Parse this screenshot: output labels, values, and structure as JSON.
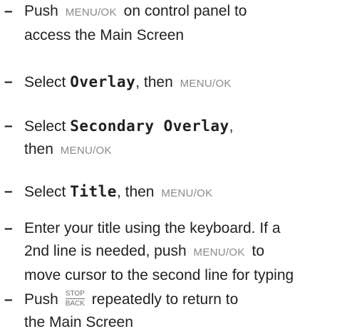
{
  "steps": [
    {
      "line1_before": "Push",
      "key": "MENU/OK",
      "line1_after": "on control panel to",
      "line2": "access the Main Screen"
    },
    {
      "before": "Select",
      "menu": "Overlay",
      "middle": ", then",
      "key": "MENU/OK"
    },
    {
      "before": "Select",
      "menu": "Secondary Overlay",
      "after": ",",
      "line2_before": "then",
      "key": "MENU/OK"
    },
    {
      "before": "Select",
      "menu": "Title",
      "middle": ", then",
      "key": "MENU/OK"
    },
    {
      "line1": "Enter your title using the keyboard. If a",
      "line2_before": "2nd line is needed, push",
      "key": "MENU/OK",
      "line2_after": "to",
      "line3": "move cursor to the second line for typing"
    },
    {
      "before": "Push",
      "key_top": "STOP",
      "key_bottom": "BACK",
      "after": "repeatedly to return to",
      "line2": "the Main Screen"
    }
  ],
  "bullet": "–"
}
